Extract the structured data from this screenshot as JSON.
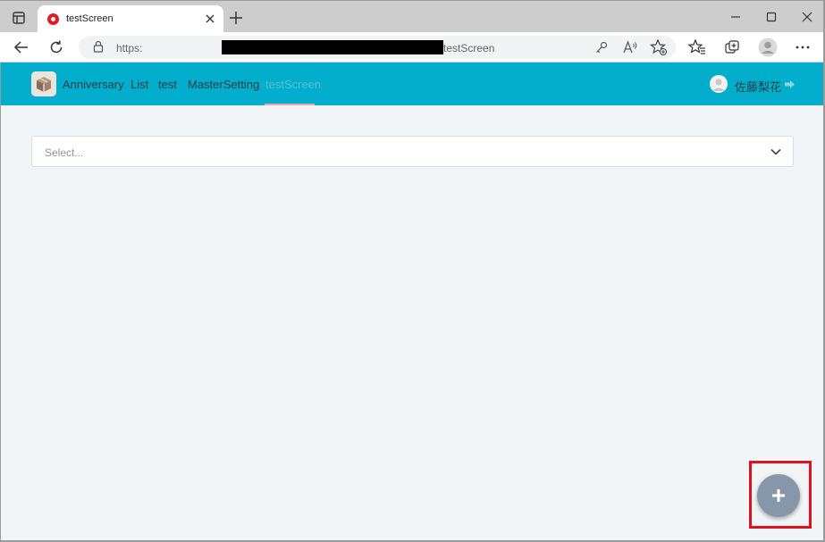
{
  "browser": {
    "tab_title": "testScreen",
    "url_prefix": "https:",
    "url_suffix": "testScreen"
  },
  "nav": {
    "links": [
      "Anniversary",
      "List",
      "test",
      "MasterSetting",
      "testScreen"
    ],
    "user_name": "佐藤梨花"
  },
  "select": {
    "placeholder": "Select..."
  },
  "colors": {
    "nav_bg": "#02aecb",
    "content_bg": "#f1f5f8",
    "fab_bg": "#8797aa",
    "highlight": "#e0111f"
  }
}
